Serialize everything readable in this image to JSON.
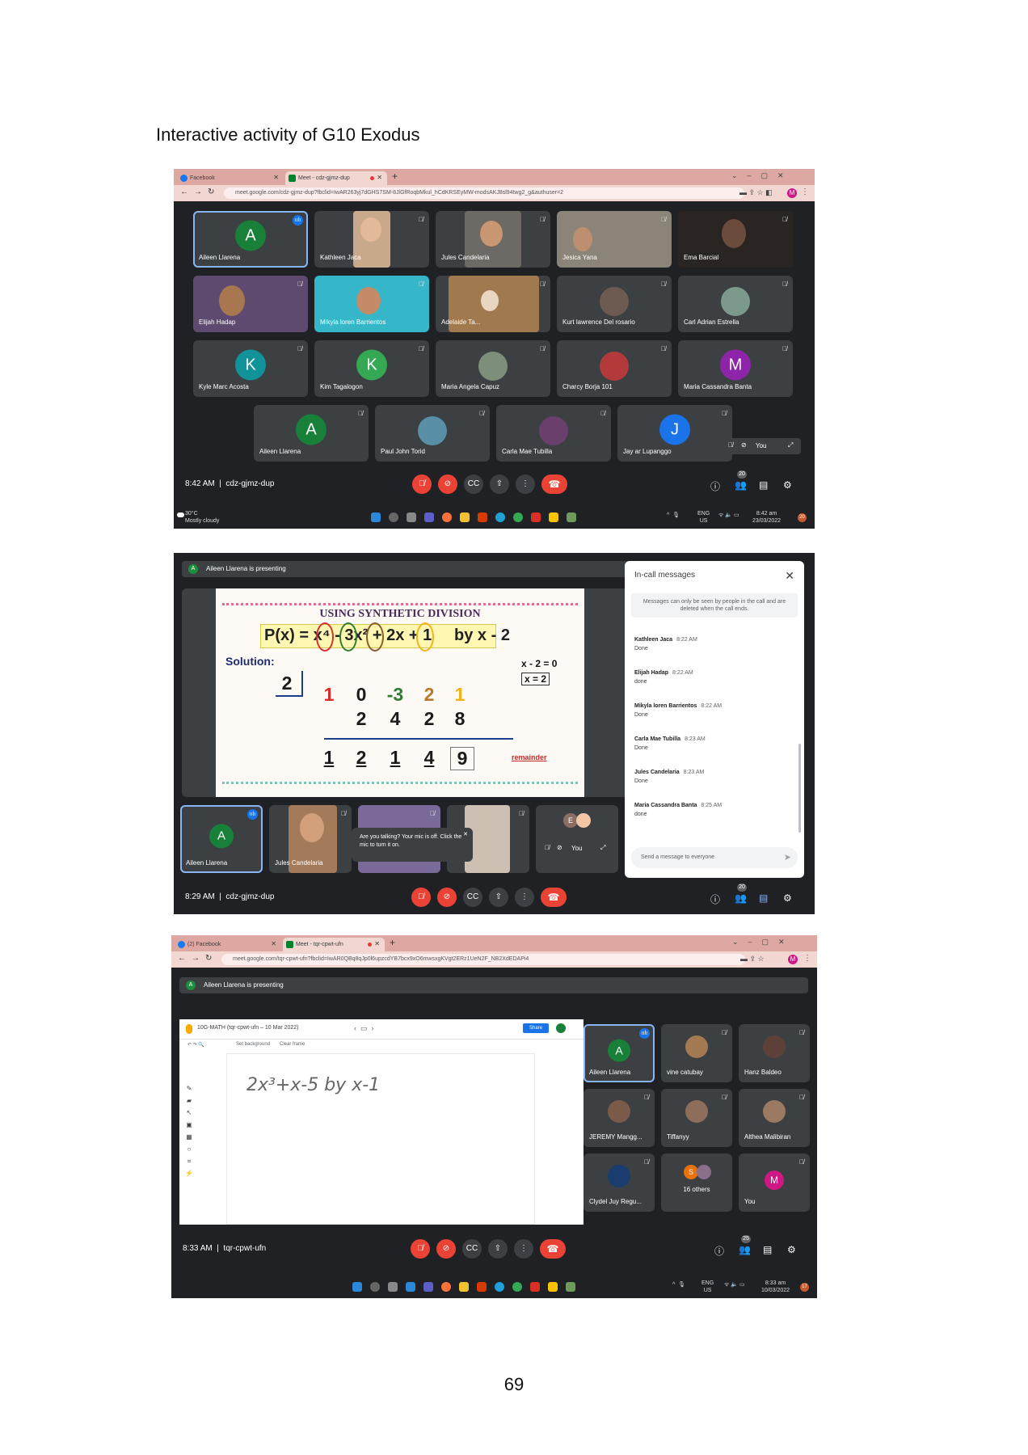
{
  "page_title": "Interactive activity of  G10 Exodus",
  "page_number": "69",
  "shot1": {
    "tabs": [
      {
        "label": "Facebook"
      },
      {
        "label": "Meet - cdz-gjmz-dup"
      }
    ],
    "url": "meet.google.com/cdz-gjmz-dup?fbclid=IwAR263yj7dGHS7SM-8JlGfRoqbMkul_hCdKRSEyMW-modsAKJ8sl94twg2_g&authuser=2",
    "participants": [
      {
        "name": "Aileen Llarena",
        "initial": "A",
        "color": "#188038"
      },
      {
        "name": "Kathleen Jaca"
      },
      {
        "name": "Jules Candelaria"
      },
      {
        "name": "Jesica Yana"
      },
      {
        "name": "Ema Barcial"
      },
      {
        "name": "Elijah Hadap"
      },
      {
        "name": "Mikyla loren Barrientos"
      },
      {
        "name": "Adelaide Ta..."
      },
      {
        "name": "Kurt lawrence Del rosario"
      },
      {
        "name": "Carl Adrian Estrella"
      },
      {
        "name": "Kyle Marc Acosta",
        "initial": "K",
        "color": "#12939a"
      },
      {
        "name": "Kim Tagalogon",
        "initial": "K",
        "color": "#34a853"
      },
      {
        "name": "Maria Angela Capuz"
      },
      {
        "name": "Charcy Borja 101"
      },
      {
        "name": "Maria Cassandra Banta",
        "initial": "M",
        "color": "#8e24aa"
      },
      {
        "name": "Aileen Llarena",
        "initial": "A",
        "color": "#188038"
      },
      {
        "name": "Paul John Torid"
      },
      {
        "name": "Carla Mae Tubilla"
      },
      {
        "name": "Jay ar Lupanggo",
        "initial": "J",
        "color": "#1a73e8"
      }
    ],
    "self_label": "You",
    "time": "8:42 AM",
    "meeting_code": "cdz-gjmz-dup",
    "people_count": "20",
    "taskbar": {
      "temp": "30°C",
      "weather": "Mostly cloudy",
      "lang": "ENG",
      "region": "US",
      "clock_time": "8:42 am",
      "clock_date": "23/03/2022",
      "notifications": "20"
    }
  },
  "shot2": {
    "presenting": "Aileen Llarena is presenting",
    "presenter_initial": "A",
    "slide": {
      "title": "USING SYNTHETIC DIVISION",
      "polynomial": "P(x) = x⁴ - 3x² + 2x + 1",
      "divisor": "by x - 2",
      "solution_label": "Solution:",
      "root": "2",
      "eq1": "x - 2 = 0",
      "eq2": "x = 2",
      "row1": [
        "1",
        "0",
        "-3",
        "2",
        "1"
      ],
      "row2": [
        "2",
        "4",
        "2",
        "8"
      ],
      "row3": [
        "1",
        "2",
        "1",
        "4",
        "9"
      ],
      "remainder_label": "remainder"
    },
    "messages_panel": {
      "title": "In-call messages",
      "note": "Messages can only be seen by people in the call and are deleted when the call ends.",
      "messages": [
        {
          "sender": "Kathleen Jaca",
          "time": "8:22 AM",
          "text": "Done"
        },
        {
          "sender": "Elijah Hadap",
          "time": "8:22 AM",
          "text": "done"
        },
        {
          "sender": "Mikyla loren Barrientos",
          "time": "8:22 AM",
          "text": "Done"
        },
        {
          "sender": "Carla Mae Tubilla",
          "time": "8:23 AM",
          "text": "Done"
        },
        {
          "sender": "Jules Candelaria",
          "time": "8:23 AM",
          "text": "Done"
        },
        {
          "sender": "Maria Cassandra Banta",
          "time": "8:25 AM",
          "text": "done"
        }
      ],
      "input_placeholder": "Send a message to everyone"
    },
    "tiles": [
      {
        "name": "Aileen Llarena",
        "initial": "A"
      },
      {
        "name": "Jules Candelaria"
      }
    ],
    "self_initial": "E",
    "self_label": "You",
    "tooltip": "Are you talking? Your mic is off. Click the mic to turn it on.",
    "time": "8:29 AM",
    "meeting_code": "cdz-gjmz-dup",
    "people_count": "20"
  },
  "shot3": {
    "tabs": [
      {
        "label": "(2) Facebook"
      },
      {
        "label": "Meet - tqr-cpwt-ufn"
      }
    ],
    "url": "meet.google.com/tqr-cpwt-ufn?fbclid=IwAR0QBq8qJp0l6upzcdYB7bcx9xO6mwsxgKVgt2ERz1UeN2F_NB2XdEDAPi4",
    "presenting": "Aileen Llarena is presenting",
    "jamboard": {
      "doc_title": "10G-MATH (tqr-cpwt-ufn – 10 Mar 2022)",
      "set_bg": "Set background",
      "clear": "Clear frame",
      "share": "Share",
      "handwriting": "2x³+x-5  by  x-1"
    },
    "participants": [
      {
        "name": "Aileen Llarena",
        "initial": "A"
      },
      {
        "name": "vine catubay"
      },
      {
        "name": "Hanz Baldeo"
      },
      {
        "name": "JEREMY Mangg..."
      },
      {
        "name": "Tiffanyy"
      },
      {
        "name": "Althea Malibiran"
      },
      {
        "name": "Clydel Juy Regu..."
      },
      {
        "name": "16 others",
        "initial": "S"
      },
      {
        "name": "You",
        "initial": "M"
      }
    ],
    "time": "8:33 AM",
    "meeting_code": "tqr-cpwt-ufn",
    "people_count": "25",
    "taskbar": {
      "lang": "ENG",
      "region": "US",
      "clock_time": "8:33 am",
      "clock_date": "10/03/2022",
      "notifications": "17"
    }
  }
}
